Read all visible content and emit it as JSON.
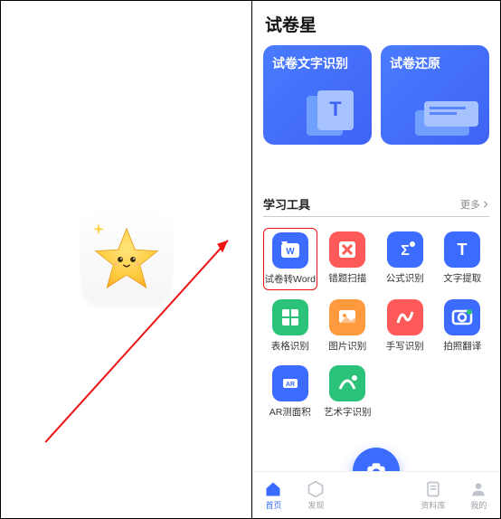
{
  "app": {
    "title": "试卷星"
  },
  "cards": [
    {
      "title": "试卷文字识别"
    },
    {
      "title": "试卷还原"
    }
  ],
  "section": {
    "title": "学习工具",
    "more": "更多"
  },
  "tools": [
    {
      "name": "word-convert",
      "label": "试卷转Word",
      "color": "blue",
      "highlight": true
    },
    {
      "name": "wrong-scan",
      "label": "错题扫描",
      "color": "red",
      "highlight": false
    },
    {
      "name": "formula-ocr",
      "label": "公式识别",
      "color": "blue",
      "highlight": false
    },
    {
      "name": "text-extract",
      "label": "文字提取",
      "color": "blue",
      "highlight": false
    },
    {
      "name": "table-ocr",
      "label": "表格识别",
      "color": "green",
      "highlight": false
    },
    {
      "name": "image-ocr",
      "label": "图片识别",
      "color": "orange",
      "highlight": false
    },
    {
      "name": "handwriting",
      "label": "手写识别",
      "color": "red",
      "highlight": false
    },
    {
      "name": "photo-translate",
      "label": "拍照翻译",
      "color": "blue",
      "highlight": false
    },
    {
      "name": "ar-area",
      "label": "AR测面积",
      "color": "blue",
      "highlight": false
    },
    {
      "name": "art-font-ocr",
      "label": "艺术字识别",
      "color": "green",
      "highlight": false
    }
  ],
  "nav": [
    {
      "name": "home",
      "label": "首页",
      "active": true
    },
    {
      "name": "discover",
      "label": "发现",
      "active": false
    },
    {
      "name": "library",
      "label": "资料库",
      "active": false
    },
    {
      "name": "me",
      "label": "我的",
      "active": false
    }
  ]
}
